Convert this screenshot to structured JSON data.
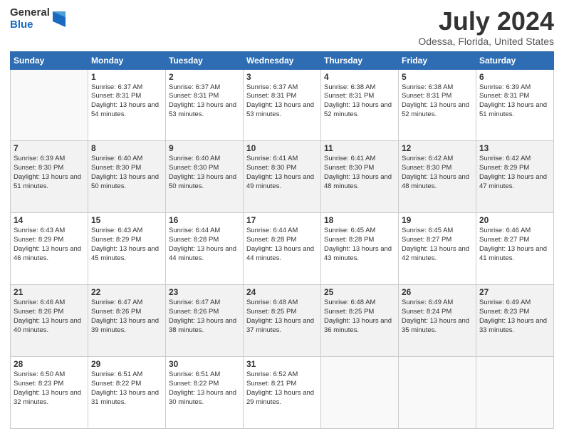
{
  "logo": {
    "general": "General",
    "blue": "Blue"
  },
  "header": {
    "month": "July 2024",
    "location": "Odessa, Florida, United States"
  },
  "weekdays": [
    "Sunday",
    "Monday",
    "Tuesday",
    "Wednesday",
    "Thursday",
    "Friday",
    "Saturday"
  ],
  "weeks": [
    [
      {
        "day": "",
        "sunrise": "",
        "sunset": "",
        "daylight": ""
      },
      {
        "day": "1",
        "sunrise": "Sunrise: 6:37 AM",
        "sunset": "Sunset: 8:31 PM",
        "daylight": "Daylight: 13 hours and 54 minutes."
      },
      {
        "day": "2",
        "sunrise": "Sunrise: 6:37 AM",
        "sunset": "Sunset: 8:31 PM",
        "daylight": "Daylight: 13 hours and 53 minutes."
      },
      {
        "day": "3",
        "sunrise": "Sunrise: 6:37 AM",
        "sunset": "Sunset: 8:31 PM",
        "daylight": "Daylight: 13 hours and 53 minutes."
      },
      {
        "day": "4",
        "sunrise": "Sunrise: 6:38 AM",
        "sunset": "Sunset: 8:31 PM",
        "daylight": "Daylight: 13 hours and 52 minutes."
      },
      {
        "day": "5",
        "sunrise": "Sunrise: 6:38 AM",
        "sunset": "Sunset: 8:31 PM",
        "daylight": "Daylight: 13 hours and 52 minutes."
      },
      {
        "day": "6",
        "sunrise": "Sunrise: 6:39 AM",
        "sunset": "Sunset: 8:31 PM",
        "daylight": "Daylight: 13 hours and 51 minutes."
      }
    ],
    [
      {
        "day": "7",
        "sunrise": "Sunrise: 6:39 AM",
        "sunset": "Sunset: 8:30 PM",
        "daylight": "Daylight: 13 hours and 51 minutes."
      },
      {
        "day": "8",
        "sunrise": "Sunrise: 6:40 AM",
        "sunset": "Sunset: 8:30 PM",
        "daylight": "Daylight: 13 hours and 50 minutes."
      },
      {
        "day": "9",
        "sunrise": "Sunrise: 6:40 AM",
        "sunset": "Sunset: 8:30 PM",
        "daylight": "Daylight: 13 hours and 50 minutes."
      },
      {
        "day": "10",
        "sunrise": "Sunrise: 6:41 AM",
        "sunset": "Sunset: 8:30 PM",
        "daylight": "Daylight: 13 hours and 49 minutes."
      },
      {
        "day": "11",
        "sunrise": "Sunrise: 6:41 AM",
        "sunset": "Sunset: 8:30 PM",
        "daylight": "Daylight: 13 hours and 48 minutes."
      },
      {
        "day": "12",
        "sunrise": "Sunrise: 6:42 AM",
        "sunset": "Sunset: 8:30 PM",
        "daylight": "Daylight: 13 hours and 48 minutes."
      },
      {
        "day": "13",
        "sunrise": "Sunrise: 6:42 AM",
        "sunset": "Sunset: 8:29 PM",
        "daylight": "Daylight: 13 hours and 47 minutes."
      }
    ],
    [
      {
        "day": "14",
        "sunrise": "Sunrise: 6:43 AM",
        "sunset": "Sunset: 8:29 PM",
        "daylight": "Daylight: 13 hours and 46 minutes."
      },
      {
        "day": "15",
        "sunrise": "Sunrise: 6:43 AM",
        "sunset": "Sunset: 8:29 PM",
        "daylight": "Daylight: 13 hours and 45 minutes."
      },
      {
        "day": "16",
        "sunrise": "Sunrise: 6:44 AM",
        "sunset": "Sunset: 8:28 PM",
        "daylight": "Daylight: 13 hours and 44 minutes."
      },
      {
        "day": "17",
        "sunrise": "Sunrise: 6:44 AM",
        "sunset": "Sunset: 8:28 PM",
        "daylight": "Daylight: 13 hours and 44 minutes."
      },
      {
        "day": "18",
        "sunrise": "Sunrise: 6:45 AM",
        "sunset": "Sunset: 8:28 PM",
        "daylight": "Daylight: 13 hours and 43 minutes."
      },
      {
        "day": "19",
        "sunrise": "Sunrise: 6:45 AM",
        "sunset": "Sunset: 8:27 PM",
        "daylight": "Daylight: 13 hours and 42 minutes."
      },
      {
        "day": "20",
        "sunrise": "Sunrise: 6:46 AM",
        "sunset": "Sunset: 8:27 PM",
        "daylight": "Daylight: 13 hours and 41 minutes."
      }
    ],
    [
      {
        "day": "21",
        "sunrise": "Sunrise: 6:46 AM",
        "sunset": "Sunset: 8:26 PM",
        "daylight": "Daylight: 13 hours and 40 minutes."
      },
      {
        "day": "22",
        "sunrise": "Sunrise: 6:47 AM",
        "sunset": "Sunset: 8:26 PM",
        "daylight": "Daylight: 13 hours and 39 minutes."
      },
      {
        "day": "23",
        "sunrise": "Sunrise: 6:47 AM",
        "sunset": "Sunset: 8:26 PM",
        "daylight": "Daylight: 13 hours and 38 minutes."
      },
      {
        "day": "24",
        "sunrise": "Sunrise: 6:48 AM",
        "sunset": "Sunset: 8:25 PM",
        "daylight": "Daylight: 13 hours and 37 minutes."
      },
      {
        "day": "25",
        "sunrise": "Sunrise: 6:48 AM",
        "sunset": "Sunset: 8:25 PM",
        "daylight": "Daylight: 13 hours and 36 minutes."
      },
      {
        "day": "26",
        "sunrise": "Sunrise: 6:49 AM",
        "sunset": "Sunset: 8:24 PM",
        "daylight": "Daylight: 13 hours and 35 minutes."
      },
      {
        "day": "27",
        "sunrise": "Sunrise: 6:49 AM",
        "sunset": "Sunset: 8:23 PM",
        "daylight": "Daylight: 13 hours and 33 minutes."
      }
    ],
    [
      {
        "day": "28",
        "sunrise": "Sunrise: 6:50 AM",
        "sunset": "Sunset: 8:23 PM",
        "daylight": "Daylight: 13 hours and 32 minutes."
      },
      {
        "day": "29",
        "sunrise": "Sunrise: 6:51 AM",
        "sunset": "Sunset: 8:22 PM",
        "daylight": "Daylight: 13 hours and 31 minutes."
      },
      {
        "day": "30",
        "sunrise": "Sunrise: 6:51 AM",
        "sunset": "Sunset: 8:22 PM",
        "daylight": "Daylight: 13 hours and 30 minutes."
      },
      {
        "day": "31",
        "sunrise": "Sunrise: 6:52 AM",
        "sunset": "Sunset: 8:21 PM",
        "daylight": "Daylight: 13 hours and 29 minutes."
      },
      {
        "day": "",
        "sunrise": "",
        "sunset": "",
        "daylight": ""
      },
      {
        "day": "",
        "sunrise": "",
        "sunset": "",
        "daylight": ""
      },
      {
        "day": "",
        "sunrise": "",
        "sunset": "",
        "daylight": ""
      }
    ]
  ]
}
